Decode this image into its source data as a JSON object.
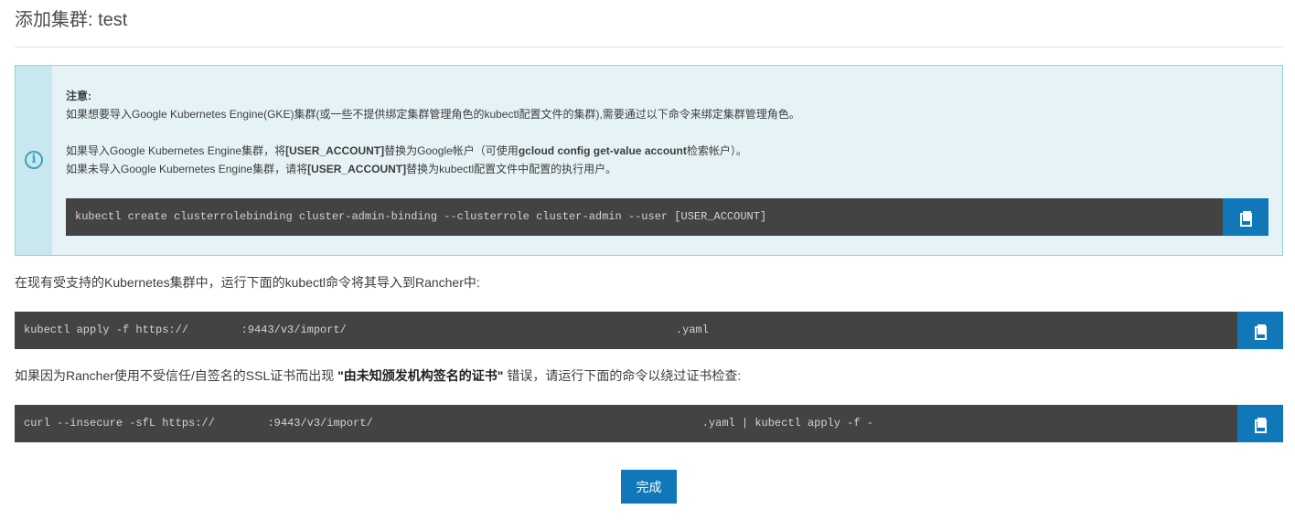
{
  "header": {
    "title": "添加集群: test"
  },
  "notice": {
    "heading": "注意:",
    "line1": "如果想要导入Google Kubernetes Engine(GKE)集群(或一些不提供绑定集群管理角色的kubectl配置文件的集群),需要通过以下命令来绑定集群管理角色。",
    "line2_prefix": "如果导入Google Kubernetes Engine集群，将",
    "line2_bold1": "[USER_ACCOUNT]",
    "line2_mid": "替换为Google帐户（可使用",
    "line2_bold2": "gcloud config get-value account",
    "line2_suffix": "检索帐户）。",
    "line3_prefix": "如果未导入Google Kubernetes Engine集群，请将",
    "line3_bold": "[USER_ACCOUNT]",
    "line3_suffix": "替换为kubectl配置文件中配置的执行用户。",
    "command": "kubectl create clusterrolebinding cluster-admin-binding --clusterrole cluster-admin --user [USER_ACCOUNT]",
    "copy_icon": "copy-icon"
  },
  "import": {
    "instruction": "在现有受支持的Kubernetes集群中，运行下面的kubectl命令将其导入到Rancher中:",
    "command": "kubectl apply -f https://        :9443/v3/import/                                                  .yaml",
    "copy_icon": "copy-icon"
  },
  "insecure": {
    "instruction_prefix": "如果因为Rancher使用不受信任/自签名的SSL证书而出现 ",
    "instruction_bold": "\"由未知颁发机构签名的证书\"",
    "instruction_suffix": " 错误，请运行下面的命令以绕过证书检查:",
    "command": "curl --insecure -sfL https://        :9443/v3/import/                                                  .yaml | kubectl apply -f -",
    "copy_icon": "copy-icon"
  },
  "footer": {
    "done_label": "完成"
  },
  "colors": {
    "accent": "#1077b8",
    "code_bg": "#434343",
    "notice_bg": "#e6f3f6",
    "notice_border": "#96d2dc",
    "info_icon": "#3aa5b9"
  }
}
